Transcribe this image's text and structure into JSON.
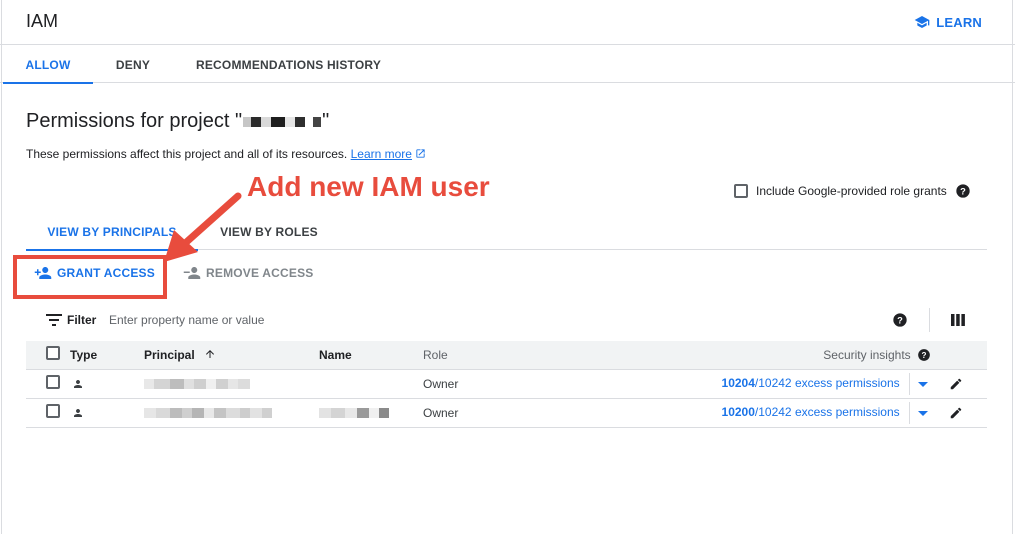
{
  "header": {
    "title": "IAM",
    "learn_label": "LEARN"
  },
  "tabs": [
    {
      "label": "ALLOW",
      "active": true
    },
    {
      "label": "DENY",
      "active": false
    },
    {
      "label": "RECOMMENDATIONS HISTORY",
      "active": false
    }
  ],
  "page": {
    "heading_prefix": "Permissions for project \"",
    "heading_suffix": "\"",
    "description": "These permissions affect this project and all of its resources.",
    "learn_more": "Learn more"
  },
  "annotation": {
    "text": "Add new IAM user",
    "color": "#e84c3d"
  },
  "include_google": {
    "label": "Include Google-provided role grants",
    "checked": false
  },
  "view_tabs": [
    {
      "label": "VIEW BY PRINCIPALS",
      "active": true
    },
    {
      "label": "VIEW BY ROLES",
      "active": false
    }
  ],
  "actions": {
    "grant": "GRANT ACCESS",
    "remove": "REMOVE ACCESS"
  },
  "filter": {
    "label": "Filter",
    "placeholder": "Enter property name or value"
  },
  "table": {
    "columns": {
      "type": "Type",
      "principal": "Principal",
      "name": "Name",
      "role": "Role",
      "insights": "Security insights"
    },
    "rows": [
      {
        "role": "Owner",
        "excess_count": "10204",
        "excess_rest": "/10242 excess permissions"
      },
      {
        "role": "Owner",
        "excess_count": "10200",
        "excess_rest": "/10242 excess permissions"
      }
    ]
  },
  "colors": {
    "accent": "#1a73e8",
    "annotation": "#e84c3d",
    "text": "#202124"
  }
}
